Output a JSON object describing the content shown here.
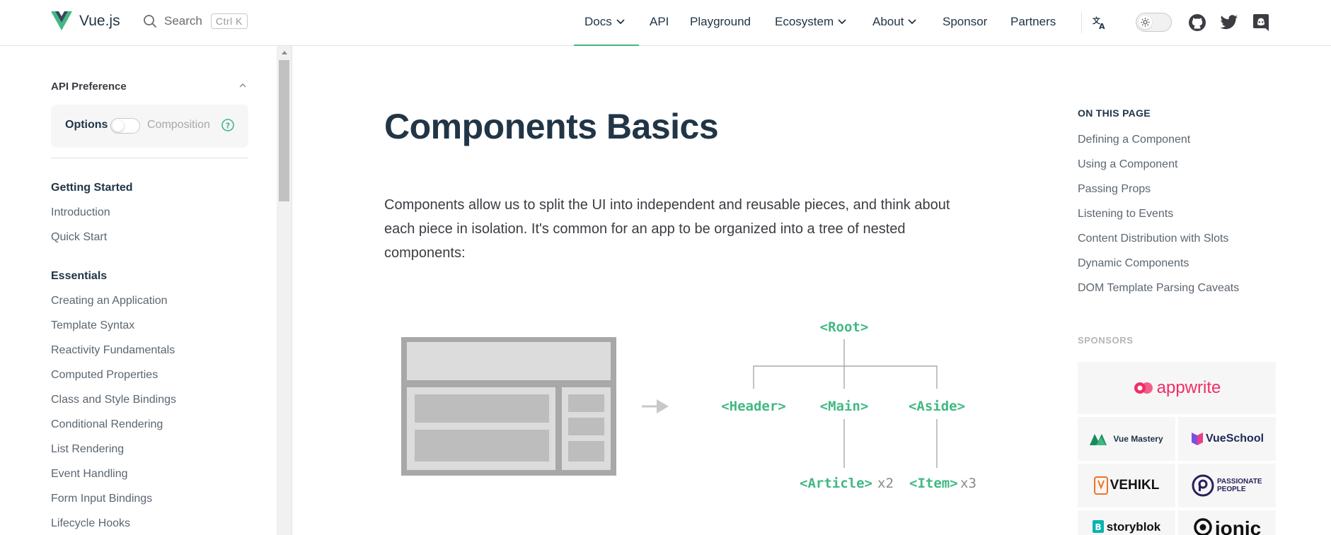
{
  "nav": {
    "brand": "Vue.js",
    "search_label": "Search",
    "search_shortcut": "Ctrl K",
    "menu": [
      {
        "label": "Docs",
        "has_dropdown": true,
        "active": true
      },
      {
        "label": "API",
        "has_dropdown": false
      },
      {
        "label": "Playground",
        "has_dropdown": false
      },
      {
        "label": "Ecosystem",
        "has_dropdown": true
      },
      {
        "label": "About",
        "has_dropdown": true
      },
      {
        "label": "Sponsor",
        "has_dropdown": false
      },
      {
        "label": "Partners",
        "has_dropdown": false
      }
    ],
    "icons": [
      "translate-icon",
      "appearance-toggle",
      "github-icon",
      "twitter-icon",
      "discord-icon"
    ],
    "accent": "#42b883"
  },
  "sidebar": {
    "api_preference": {
      "label": "API Preference",
      "option_a": "Options",
      "option_b": "Composition",
      "selected": "Options"
    },
    "groups": [
      {
        "title": "Getting Started",
        "items": [
          "Introduction",
          "Quick Start"
        ]
      },
      {
        "title": "Essentials",
        "items": [
          "Creating an Application",
          "Template Syntax",
          "Reactivity Fundamentals",
          "Computed Properties",
          "Class and Style Bindings",
          "Conditional Rendering",
          "List Rendering",
          "Event Handling",
          "Form Input Bindings",
          "Lifecycle Hooks"
        ]
      }
    ]
  },
  "main": {
    "title": "Components Basics",
    "intro": "Components allow us to split the UI into independent and reusable pieces, and think about each piece in isolation. It's common for an app to be organized into a tree of nested components:",
    "diagram": {
      "root": "<Root>",
      "children": [
        "<Header>",
        "<Main>",
        "<Aside>"
      ],
      "article": "<Article>",
      "article_count": "x2",
      "item": "<Item>",
      "item_count": "x3"
    }
  },
  "aside": {
    "toc_title": "ON THIS PAGE",
    "toc": [
      "Defining a Component",
      "Using a Component",
      "Passing Props",
      "Listening to Events",
      "Content Distribution with Slots",
      "Dynamic Components",
      "DOM Template Parsing Caveats"
    ],
    "sponsors_title": "SPONSORS",
    "sponsors": [
      "appwrite",
      "Vue Mastery",
      "VueSchool",
      "VEHIKL",
      "PASSIONATE PEOPLE",
      "storyblok",
      "ionic"
    ]
  }
}
